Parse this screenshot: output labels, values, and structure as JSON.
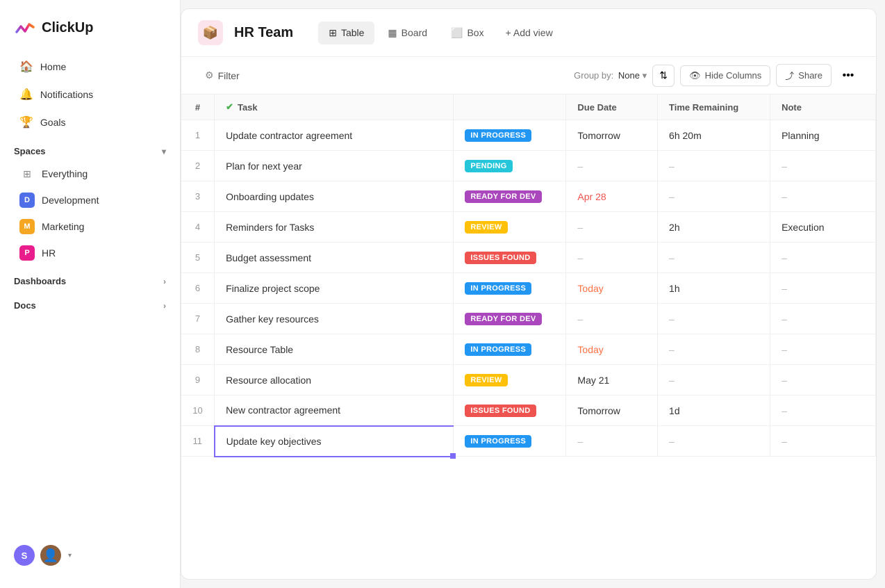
{
  "app": {
    "name": "ClickUp"
  },
  "sidebar": {
    "nav_items": [
      {
        "id": "home",
        "label": "Home",
        "icon": "🏠"
      },
      {
        "id": "notifications",
        "label": "Notifications",
        "icon": "🔔"
      },
      {
        "id": "goals",
        "label": "Goals",
        "icon": "🏆"
      }
    ],
    "spaces_label": "Spaces",
    "space_items": [
      {
        "id": "everything",
        "label": "Everything",
        "type": "everything"
      },
      {
        "id": "development",
        "label": "Development",
        "color": "#4F6FE8",
        "initial": "D"
      },
      {
        "id": "marketing",
        "label": "Marketing",
        "color": "#F5A623",
        "initial": "M"
      },
      {
        "id": "hr",
        "label": "HR",
        "color": "#E91E8C",
        "initial": "P"
      }
    ],
    "section_items": [
      {
        "id": "dashboards",
        "label": "Dashboards"
      },
      {
        "id": "docs",
        "label": "Docs"
      }
    ],
    "user_initial": "S"
  },
  "topbar": {
    "space_icon": "📦",
    "title": "HR Team",
    "views": [
      {
        "id": "table",
        "label": "Table",
        "active": true
      },
      {
        "id": "board",
        "label": "Board",
        "active": false
      },
      {
        "id": "box",
        "label": "Box",
        "active": false
      }
    ],
    "add_view_label": "+ Add view"
  },
  "toolbar": {
    "filter_label": "Filter",
    "group_by_label": "Group by:",
    "group_by_value": "None",
    "sort_label": "",
    "hide_columns_label": "Hide Columns",
    "share_label": "Share"
  },
  "table": {
    "columns": [
      "#",
      "Task",
      "",
      "Due Date",
      "Time Remaining",
      "Note"
    ],
    "rows": [
      {
        "num": 1,
        "task": "Update contractor agreement",
        "status": "IN PROGRESS",
        "status_type": "in-progress",
        "due_date": "Tomorrow",
        "due_type": "normal",
        "time_remaining": "6h 20m",
        "note": "Planning"
      },
      {
        "num": 2,
        "task": "Plan for next year",
        "status": "PENDING",
        "status_type": "pending",
        "due_date": "–",
        "due_type": "dash",
        "time_remaining": "–",
        "note": "–"
      },
      {
        "num": 3,
        "task": "Onboarding updates",
        "status": "READY FOR DEV",
        "status_type": "ready-for-dev",
        "due_date": "Apr 28",
        "due_type": "overdue",
        "time_remaining": "–",
        "note": "–"
      },
      {
        "num": 4,
        "task": "Reminders for Tasks",
        "status": "REVIEW",
        "status_type": "review",
        "due_date": "–",
        "due_type": "dash",
        "time_remaining": "2h",
        "note": "Execution"
      },
      {
        "num": 5,
        "task": "Budget assessment",
        "status": "ISSUES FOUND",
        "status_type": "issues-found",
        "due_date": "–",
        "due_type": "dash",
        "time_remaining": "–",
        "note": "–"
      },
      {
        "num": 6,
        "task": "Finalize project scope",
        "status": "IN PROGRESS",
        "status_type": "in-progress",
        "due_date": "Today",
        "due_type": "today",
        "time_remaining": "1h",
        "note": "–"
      },
      {
        "num": 7,
        "task": "Gather key resources",
        "status": "READY FOR DEV",
        "status_type": "ready-for-dev",
        "due_date": "–",
        "due_type": "dash",
        "time_remaining": "–",
        "note": "–"
      },
      {
        "num": 8,
        "task": "Resource Table",
        "status": "IN PROGRESS",
        "status_type": "in-progress",
        "due_date": "Today",
        "due_type": "today",
        "time_remaining": "–",
        "note": "–"
      },
      {
        "num": 9,
        "task": "Resource allocation",
        "status": "REVIEW",
        "status_type": "review",
        "due_date": "May 21",
        "due_type": "normal",
        "time_remaining": "–",
        "note": "–"
      },
      {
        "num": 10,
        "task": "New contractor agreement",
        "status": "ISSUES FOUND",
        "status_type": "issues-found",
        "due_date": "Tomorrow",
        "due_type": "normal",
        "time_remaining": "1d",
        "note": "–"
      },
      {
        "num": 11,
        "task": "Update key objectives",
        "status": "IN PROGRESS",
        "status_type": "in-progress",
        "due_date": "–",
        "due_type": "dash",
        "time_remaining": "–",
        "note": "–",
        "selected": true
      }
    ]
  }
}
